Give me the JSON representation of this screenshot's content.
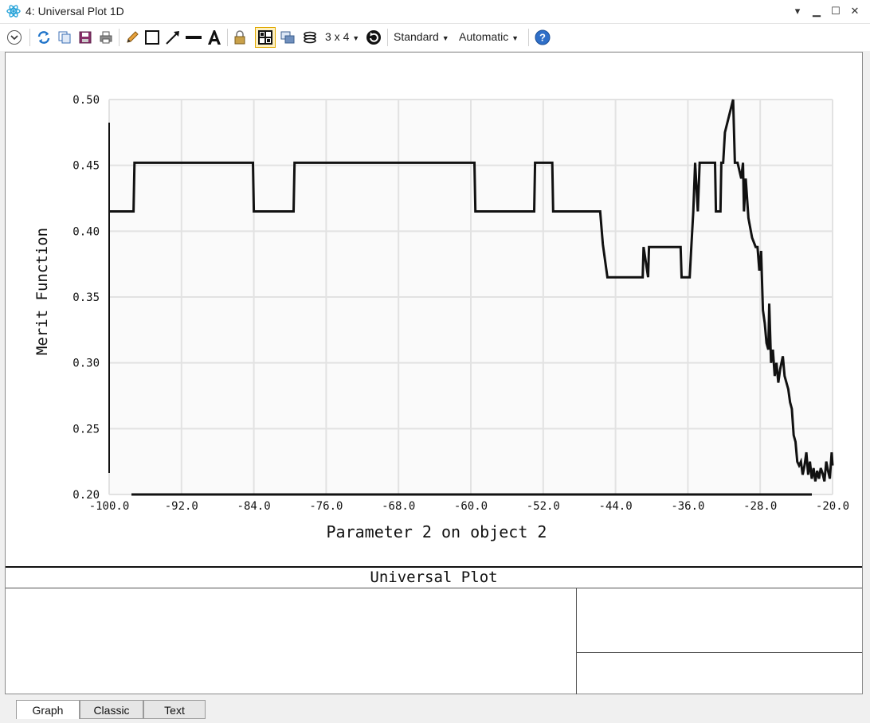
{
  "window": {
    "title": "4: Universal Plot 1D"
  },
  "toolbar": {
    "layout_label": "3 x 4",
    "standard_label": "Standard",
    "automatic_label": "Automatic"
  },
  "chart_data": {
    "type": "line",
    "title": "",
    "xlabel": "Parameter 2 on object 2",
    "ylabel": "Merit Function",
    "xlim": [
      -100,
      -20
    ],
    "ylim": [
      0.2,
      0.5
    ],
    "x_ticks": [
      "-100.0",
      "-92.0",
      "-84.0",
      "-76.0",
      "-68.0",
      "-60.0",
      "-52.0",
      "-44.0",
      "-36.0",
      "-28.0",
      "-20.0"
    ],
    "y_ticks": [
      "0.50",
      "0.45",
      "0.40",
      "0.35",
      "0.30",
      "0.25",
      "0.20"
    ],
    "grid": true,
    "series": [
      {
        "x": [
          -100,
          -97.3,
          -97.2,
          -84.1,
          -84.0,
          -79.6,
          -79.5,
          -59.6,
          -59.5,
          -53.0,
          -52.9,
          -51.0,
          -50.9,
          -45.7,
          -45.4,
          -44.9,
          -44.1,
          -43.9,
          -42.5,
          -41.0,
          -40.9,
          -40.4,
          -40.3,
          -39.6,
          -39.5,
          -36.8,
          -36.7,
          -35.8,
          -35.6,
          -35.4,
          -35.2,
          -34.9,
          -34.7,
          -33.0,
          -32.9,
          -32.4,
          -32.3,
          -32.1,
          -31.9,
          -31.0,
          -30.8,
          -30.5,
          -30.1,
          -29.9,
          -29.8,
          -29.6,
          -29.3,
          -28.9,
          -28.5,
          -28.3,
          -28.1,
          -27.9,
          -27.7,
          -27.5,
          -27.3,
          -27.1,
          -27.0,
          -26.8,
          -26.6,
          -26.4,
          -26.2,
          -26.0,
          -25.8,
          -25.5,
          -25.3,
          -25.1,
          -24.9,
          -24.7,
          -24.5,
          -24.3,
          -24.1,
          -23.9,
          -23.7,
          -23.5,
          -23.3,
          -23.1,
          -22.9,
          -22.7,
          -22.5,
          -22.3,
          -22.1,
          -21.9,
          -21.7,
          -21.5,
          -21.3,
          -21.1,
          -20.9,
          -20.7,
          -20.5,
          -20.3,
          -20.1,
          -20.0
        ],
        "y": [
          0.415,
          0.415,
          0.452,
          0.452,
          0.415,
          0.415,
          0.452,
          0.452,
          0.415,
          0.415,
          0.452,
          0.452,
          0.415,
          0.415,
          0.39,
          0.365,
          0.365,
          0.365,
          0.365,
          0.365,
          0.388,
          0.365,
          0.388,
          0.388,
          0.388,
          0.388,
          0.365,
          0.365,
          0.39,
          0.415,
          0.452,
          0.415,
          0.452,
          0.452,
          0.415,
          0.415,
          0.452,
          0.452,
          0.475,
          0.5,
          0.452,
          0.452,
          0.44,
          0.452,
          0.415,
          0.44,
          0.41,
          0.395,
          0.388,
          0.388,
          0.37,
          0.385,
          0.34,
          0.33,
          0.315,
          0.31,
          0.345,
          0.3,
          0.31,
          0.29,
          0.3,
          0.285,
          0.295,
          0.305,
          0.29,
          0.285,
          0.28,
          0.27,
          0.265,
          0.245,
          0.24,
          0.225,
          0.222,
          0.225,
          0.215,
          0.222,
          0.232,
          0.215,
          0.225,
          0.212,
          0.22,
          0.21,
          0.218,
          0.212,
          0.22,
          0.216,
          0.21,
          0.225,
          0.218,
          0.212,
          0.232,
          0.222
        ]
      }
    ]
  }
}
